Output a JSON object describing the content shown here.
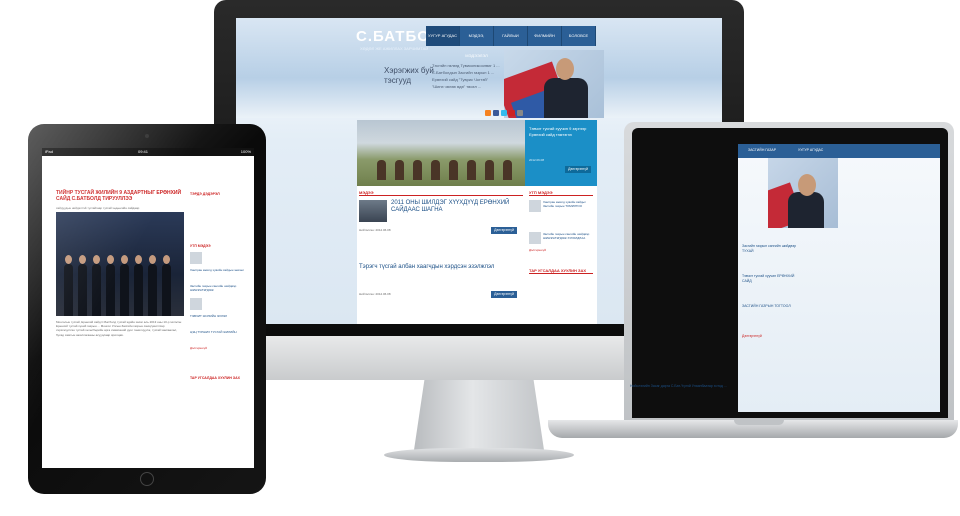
{
  "imac_site": {
    "logo": "С.БАТБОЛД",
    "logo_sub": "ХӨДӨЛ ЖЕ АЖИЛЛАХ ЗАРЧИМТАЙ",
    "nav": [
      "УУГУР АГУДАС",
      "МЭДЭЭ, МЭДЭЭЛЭЛ",
      "ГАЙЛЫИ",
      "ФИЛМИЙН САНАЛ",
      "БОЛОВСЕ БЭЛЭН"
    ],
    "hero_quote": "Хэрэгжих буй тэсгууд",
    "hero_links": [
      "Тэсгэйн гөлөгд Тувиконикоолвиг 1 ...",
      "С.Батболдын Засгийн газрын 1 ...",
      "Ерөнхий сайд \"Туврис Чогтэй\"",
      "\"Шинэ чөлөө өдө\" төсөл ..."
    ],
    "slider_box_text": "Тэвчит тусгай хуучин 9 зэргээр Ерөнхий сайд тэмтэгээ",
    "slider_box_date": "2012.06.08",
    "slider_box_button": "Дэлгэрэнгүй",
    "section_news": "МЭДЭЭ",
    "news": [
      {
        "title": "2011 ОНЫ ШИЛДЭГ ХҮҮХДҮҮД ЕРӨНХИЙ САЙДААС ШАГНА",
        "meta": "Нийтэлсэн: 2012.06.08",
        "button": "Дэлгэрэнгүй"
      },
      {
        "title": "Тэрэгч түсгай албан хаагчдын хэрдсэн эзэлжлэл",
        "meta": "Нийтэлсэн: 2012.06.08",
        "button": "Дэлгэрэнгүй"
      }
    ],
    "section_side": "УТП МЭДЭЭ",
    "side_items": [
      "Хамтран ажилд хувийн сайдыг Засгийн газрын ТОМИЛГОО",
      "Засгийн газрын сангийн шийдвэр ШИНЭЧЛЭГДЭЖ ХУРАЛДЛАА"
    ],
    "side_link": "Дэлгэрэнгүй",
    "section_popular": "ТАР УГСАЛДАА ХУУЛИН ЗАХ"
  },
  "laptop_site": {
    "nav": [
      "ЗАСГИЙН ГАЗАР",
      "УУГУР АГУДАС"
    ],
    "items": [
      "Засгийн газрын сангийн шийдвэр ТУХАЙ",
      "Тэвчит тусгай хуучин ЕРӨНХИЙ САЙД",
      "ЗАСГИЙН ГАЗРЫН ТОГТООЛ",
      "Дэлгэрэнгүй"
    ],
    "bottom": "Нийслэлийн Засаг дарга С.Бат-Үүлэй Улаанбаатар хотод ..."
  },
  "ipad_site": {
    "status_left": "iPad",
    "status_time": "09:41",
    "status_right": "100%",
    "headline": "ТИЙНР ТУСГАЙ ЖИЛИЙН 9 АЗДАРТНЫГ ЕРӨНХИЙ САЙД С.БАТБОЛД ТИРУУЛЛЭЭ",
    "sub": "сайдуудын нийдэлтэй тусгайгаар тусгай хөдөөгийн сайдаар",
    "body": "Монголын тусгай, Ерөнхий сайд С.Батболд тусгай эдийн засаг аль 2013 оны 10-р эхлэсэн Ерөнхий тусгай хүний газрын ... Монгол Улсын Засгийн газрын санхүүжилтээр хэрэгжүүлсэн тусгай хөтөлбөрийн арга хэмжээний дүнг танилцуулж, тусгай хамгаалал, бусад хамтын ажиллагааны асуудлаар ярилцав.",
    "side_title_1": "ТЭРДЭ ДЭДЭРЭЛ",
    "side_title_2": "УТП МЭДЭЭ",
    "side_items": [
      "Хамтран ажилд хувийн сайдын зөвлөл",
      "Засгийн газрын сангийн шийдвэр ШИНЭЧЛЭГДЭЖ",
      "ТЭВЧИТ ЖИЛИЙН ЭХЛЭЛ",
      "ЦЭЦ ТУРШИХ ТУСГАЙ ЖИЛИЙН"
    ],
    "side_link": "Дэлгэрэнгүй",
    "side_title_3": "ТАР УГСАЛДАА ХУУЛИН ЗАХ"
  },
  "colors": {
    "brand_blue": "#2b5f96",
    "accent_red": "#cc2222",
    "cyan": "#1b8fc7"
  }
}
